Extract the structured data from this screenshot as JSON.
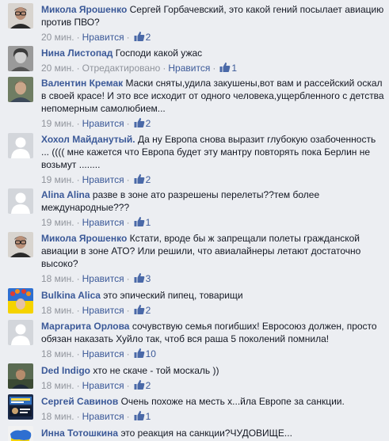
{
  "ui": {
    "like": "Нравится",
    "edited": "Отредактировано",
    "sep": "·"
  },
  "comments": [
    {
      "author": "Микола Ярошенко",
      "text": "Сергей Горбачевский, это какой гений посылает авиацию против ПВО?",
      "time": "20 мин.",
      "likes": "2",
      "avatar": "portrait-mykola"
    },
    {
      "author": "Нина Листопад",
      "text": "Господи какой ужас",
      "time": "20 мин.",
      "edited": true,
      "likes": "1",
      "avatar": "portrait-nina"
    },
    {
      "author": "Валентин Кремак",
      "text": "Маски сняты,удила закушены,вот вам и рассейский оскал в своей красе! И это все исходит от одного человека,ущербленного с детства непомерным самолюбием...",
      "time": "19 мин.",
      "likes": "2",
      "avatar": "portrait-valentin"
    },
    {
      "author": "Хохол Майданутый.",
      "text": "Да ну Европа снова выразит глубокую озабоченность ... (((( мне кажется что Европа будет эту мантру повторять пока Берлин не возьмут ........",
      "time": "19 мин.",
      "likes": "2",
      "avatar": "default-silhouette"
    },
    {
      "author": "Alina Alina",
      "text": "разве в зоне ато разрешены перелеты??тем более международные???",
      "time": "19 мин.",
      "likes": "1",
      "avatar": "default-silhouette"
    },
    {
      "author": "Микола Ярошенко",
      "text": "Кстати, вроде бы ж запрещали полеты гражданской авиации в зоне АТО? Или решили, что авиалайнеры летают достаточно высоко?",
      "time": "18 мин.",
      "likes": "3",
      "avatar": "portrait-mykola"
    },
    {
      "author": "Bulkina Alica",
      "text": "это эпический пипец, товарищи",
      "time": "18 мин.",
      "likes": "2",
      "avatar": "ukraine-wreath"
    },
    {
      "author": "Маргарита Орлова",
      "text": "сочувствую семья погибших! Евросоюз должен, просто обязан наказать Хуйло так, чтоб вся раша 5 поколений помнила!",
      "time": "18 мин.",
      "likes": "10",
      "avatar": "default-silhouette"
    },
    {
      "author": "Ded Indigo",
      "text": "хто не скаче - той москаль ))",
      "time": "18 мин.",
      "likes": "2",
      "avatar": "portrait-ded"
    },
    {
      "author": "Сергей Савинов",
      "text": "Очень похоже на месть х...йла Европе за санкции.",
      "time": "18 мин.",
      "likes": "1",
      "avatar": "poster-sergey"
    },
    {
      "author": "Инна Тотошкина",
      "text": "это реакция на санкции?ЧУДОВИЩЕ...",
      "time": "",
      "likes": "",
      "avatar": "ukraine-map"
    }
  ],
  "colors": {
    "link": "#3b5998",
    "meta": "#90949c",
    "text": "#141823",
    "background": "#eceef2"
  }
}
